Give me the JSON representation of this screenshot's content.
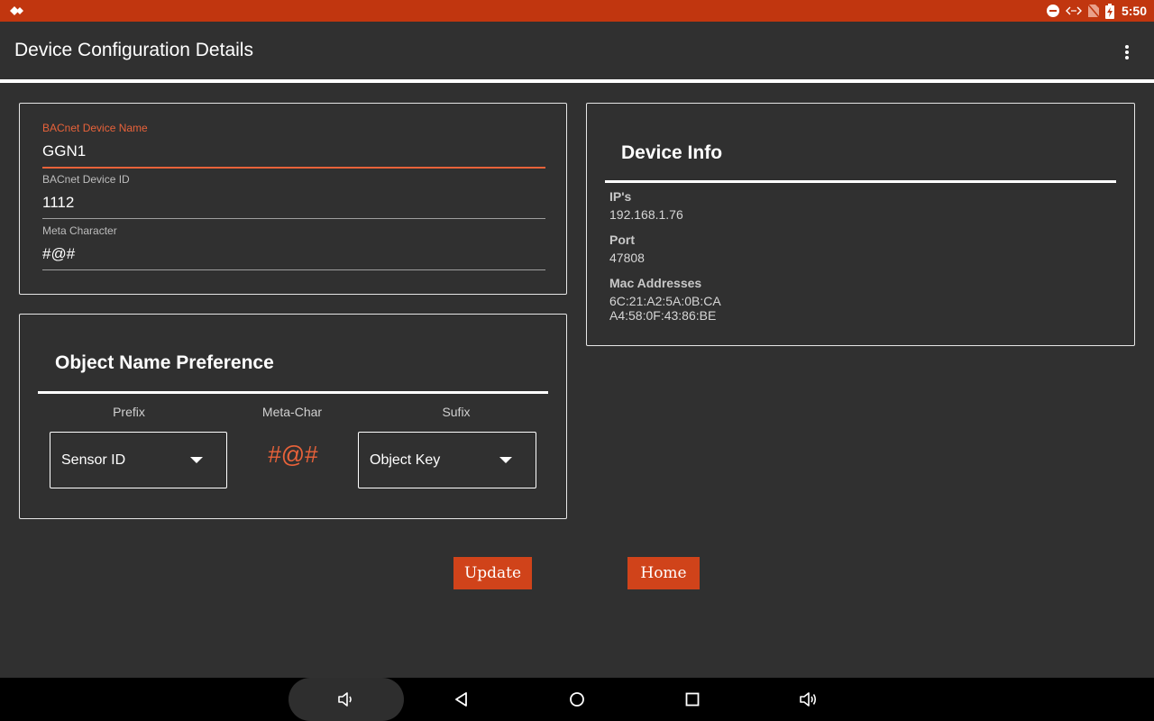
{
  "status_bar": {
    "time": "5:50",
    "icons": [
      "app-notification-icon",
      "do-not-disturb-icon",
      "data-saver-icon",
      "no-sim-icon",
      "battery-charging-icon"
    ]
  },
  "app_bar": {
    "title": "Device Configuration Details",
    "menu_icon": "more-vert-icon"
  },
  "config": {
    "device_name": {
      "label": "BACnet Device Name",
      "value": "GGN1"
    },
    "device_id": {
      "label": "BACnet Device ID",
      "value": "1112"
    },
    "meta_character": {
      "label": "Meta Character",
      "value": "#@#"
    }
  },
  "object_name": {
    "title": "Object Name Preference",
    "prefix_label": "Prefix",
    "meta_label": "Meta-Char",
    "suffix_label": "Sufix",
    "prefix_value": "Sensor ID",
    "meta_value": "#@#",
    "suffix_value": "Object Key"
  },
  "device_info": {
    "title": "Device Info",
    "ip_label": "IP's",
    "ip_value": "192.168.1.76",
    "port_label": "Port",
    "port_value": "47808",
    "mac_label": "Mac Addresses",
    "mac_values": [
      "6C:21:A2:5A:0B:CA",
      "A4:58:0F:43:86:BE"
    ]
  },
  "buttons": {
    "update": "Update",
    "home": "Home"
  },
  "colors": {
    "accent": "#c1360f",
    "button": "#d0431a",
    "highlight": "#e8623a",
    "background": "#303030"
  },
  "nav_bar": {
    "icons": [
      "volume-down-icon",
      "back-icon",
      "home-icon",
      "recents-icon",
      "volume-up-icon"
    ]
  }
}
